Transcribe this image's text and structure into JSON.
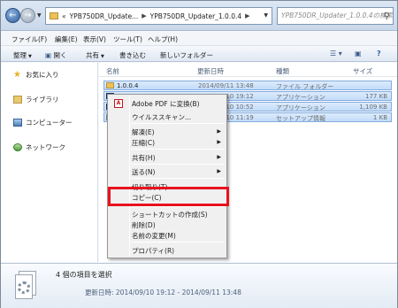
{
  "address": {
    "prefix": "«",
    "crumbs": [
      "YPB750DR_Update...",
      "YPB750DR_Updater_1.0.0.4"
    ],
    "search_placeholder": "YPB750DR_Updater_1.0.0.4の検索"
  },
  "menubar": [
    "ファイル(F)",
    "編集(E)",
    "表示(V)",
    "ツール(T)",
    "ヘルプ(H)"
  ],
  "cmdbar": [
    "整理",
    "開く",
    "共有",
    "書き込む",
    "新しいフォルダー"
  ],
  "nav": [
    "お気に入り",
    "ライブラリ",
    "コンピューター",
    "ネットワーク"
  ],
  "columns": {
    "name": "名前",
    "date": "更新日時",
    "type": "種類",
    "size": "サイズ"
  },
  "rows": [
    {
      "name": "1.0.0.4",
      "date": "2014/09/11 13:48",
      "type": "ファイル フォルダー",
      "size": "",
      "icon": "folder-icon"
    },
    {
      "name": "",
      "date": "2014/09/10 19:12",
      "type": "アプリケーション",
      "size": "177 KB",
      "icon": "app-icon"
    },
    {
      "name": "",
      "date": "2014/09/10 10:52",
      "type": "アプリケーション",
      "size": "1,109 KB",
      "icon": "app-icon"
    },
    {
      "name": "",
      "date": "2014/09/10 11:19",
      "type": "セットアップ情報",
      "size": "1 KB",
      "icon": "setup-icon"
    }
  ],
  "context_menu": {
    "pdf": "Adobe PDF に変換(B)",
    "scan": "ウイルススキャン...",
    "extract": "解凍(E)",
    "compress": "圧縮(C)",
    "share": "共有(H)",
    "sendto": "送る(N)",
    "cut": "切り取り(T)",
    "copy": "コピー(C)",
    "shortcut": "ショートカットの作成(S)",
    "delete": "削除(D)",
    "rename": "名前の変更(M)",
    "properties": "プロパティ(R)",
    "highlight_color": "#e8121e"
  },
  "details": {
    "title": "4 個の項目を選択",
    "modified": "更新日時: 2014/09/10 19:12 - 2014/09/11 13:48"
  }
}
